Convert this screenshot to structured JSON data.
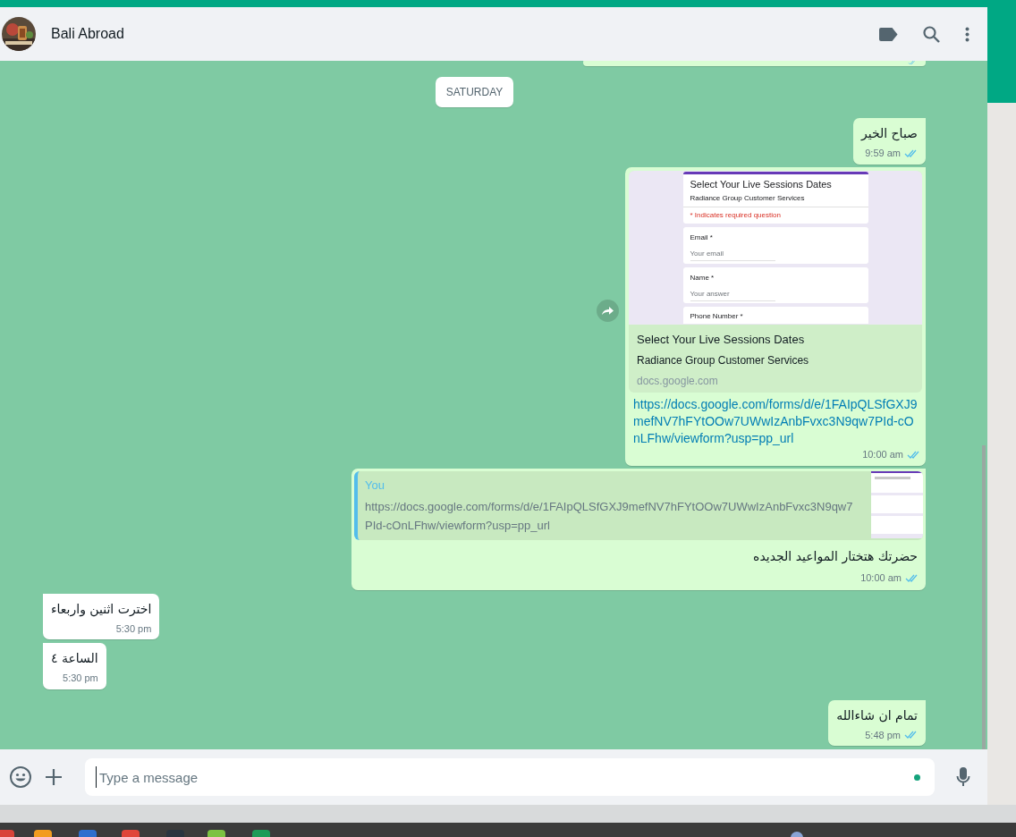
{
  "header": {
    "contact_name": "Bali Abroad"
  },
  "messages": [
    {
      "kind": "partial",
      "outgoing": true,
      "read": true
    },
    {
      "kind": "date",
      "text": "SATURDAY"
    },
    {
      "kind": "text",
      "outgoing": true,
      "text": "صباح الخير",
      "time": "9:59 am",
      "read": true
    },
    {
      "kind": "link",
      "outgoing": true,
      "preview": {
        "form": {
          "title": "Select Your Live Sessions Dates",
          "subtitle": "Radiance Group Customer Services",
          "note": "* Indicates required question",
          "fields": [
            {
              "label": "Email *",
              "hint": "Your email"
            },
            {
              "label": "Name *",
              "hint": "Your answer"
            }
          ],
          "last_label": "Phone Number *"
        },
        "title": "Select Your Live Sessions Dates",
        "subtitle": "Radiance Group Customer Services",
        "domain": "docs.google.com"
      },
      "url": "https://docs.google.com/forms/d/e/1FAIpQLSfGXJ9mefNV7hFYtOOw7UWwIzAnbFvxc3N9qw7PId-cOnLFhw/viewform?usp=pp_url",
      "time": "10:00 am",
      "read": true
    },
    {
      "kind": "reply",
      "outgoing": true,
      "quote": {
        "author": "You",
        "text": "https://docs.google.com/forms/d/e/1FAIpQLSfGXJ9mefNV7hFYtOOw7UWwIzAnbFvxc3N9qw7PId-cOnLFhw/viewform?usp=pp_url"
      },
      "text": "حضرتك هتختار المواعيد الجديده",
      "time": "10:00 am",
      "read": true
    },
    {
      "kind": "text",
      "outgoing": false,
      "text": "اخترت اثنين واربعاء",
      "time": "5:30 pm"
    },
    {
      "kind": "text",
      "outgoing": false,
      "text": "الساعة ٤",
      "time": "5:30 pm"
    },
    {
      "kind": "text",
      "outgoing": true,
      "text": "تمام ان شاءالله",
      "time": "5:48 pm",
      "read": true
    }
  ],
  "composer": {
    "placeholder": "Type a message"
  }
}
